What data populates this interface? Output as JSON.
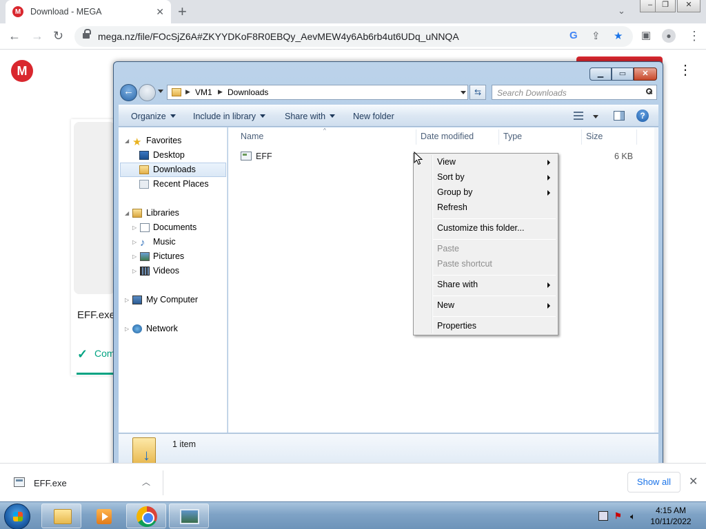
{
  "browser": {
    "tab_title": "Download - MEGA",
    "tab_favicon": "M",
    "url": "mega.nz/file/FOcSjZ6A#ZKYYDKoF8R0EBQy_AevMEW4y6Ab6rb4ut6UDq_uNNQA"
  },
  "mega": {
    "logo": "M",
    "file_name": "EFF.exe",
    "status": "Com",
    "accent_color": "#d9272e",
    "success_color": "#00a382"
  },
  "explorer": {
    "breadcrumb": [
      "VM1",
      "Downloads"
    ],
    "search_placeholder": "Search Downloads",
    "commands": {
      "organize": "Organize",
      "include_in_library": "Include in library",
      "share_with": "Share with",
      "new_folder": "New folder"
    },
    "nav": {
      "favorites": "Favorites",
      "desktop": "Desktop",
      "downloads": "Downloads",
      "recent_places": "Recent Places",
      "libraries": "Libraries",
      "documents": "Documents",
      "music": "Music",
      "pictures": "Pictures",
      "videos": "Videos",
      "my_computer": "My Computer",
      "network": "Network"
    },
    "columns": {
      "name": "Name",
      "date_modified": "Date modified",
      "type": "Type",
      "size": "Size"
    },
    "files": [
      {
        "name": "EFF",
        "date_modified": "",
        "type": "",
        "size": "6 KB"
      }
    ],
    "item_count": "1 item"
  },
  "context_menu": {
    "view": "View",
    "sort_by": "Sort by",
    "group_by": "Group by",
    "refresh": "Refresh",
    "customize": "Customize this folder...",
    "paste": "Paste",
    "paste_shortcut": "Paste shortcut",
    "share_with": "Share with",
    "new": "New",
    "properties": "Properties"
  },
  "download_shelf": {
    "file_name": "EFF.exe",
    "show_all": "Show all"
  },
  "taskbar": {
    "time": "4:15 AM",
    "date": "10/11/2022"
  }
}
